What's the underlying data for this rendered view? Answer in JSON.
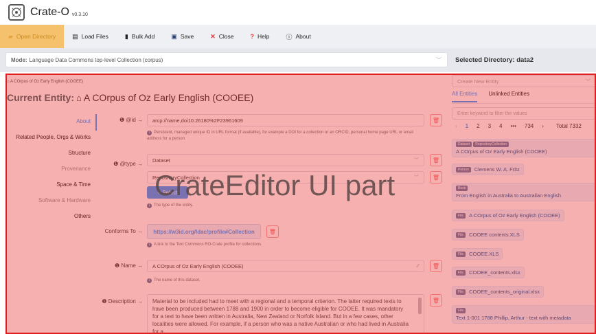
{
  "app": {
    "name": "Crate-O",
    "version": "v0.3.10"
  },
  "toolbar": {
    "items": [
      {
        "label": "Open Directory",
        "icon": "folder-open-icon",
        "active": true
      },
      {
        "label": "Load Files",
        "icon": "load-files-icon"
      },
      {
        "label": "Bulk Add",
        "icon": "bulk-add-icon"
      },
      {
        "label": "Save",
        "icon": "save-icon"
      },
      {
        "label": "Close",
        "icon": "close-icon"
      },
      {
        "label": "Help",
        "icon": "help-icon"
      },
      {
        "label": "About",
        "icon": "about-icon"
      }
    ]
  },
  "modebar": {
    "mode_label": "Mode:",
    "mode_value": "Language Data Commons top-level Collection (corpus)",
    "selected_dir": "Selected Directory: data2"
  },
  "editor": {
    "breadcrumb": "A COrpus of Oz Early English (COOEE)",
    "current_label": "Current Entity:",
    "current_name": "A COrpus of Oz Early English (COOEE)",
    "nav": [
      "About",
      "Related People, Orgs & Works",
      "Structure",
      "Provenance",
      "Space & Time",
      "Software & Hardware",
      "Others"
    ],
    "id_label": "@id →",
    "id_value": "arcp://name,doi10.26180%2F23961609",
    "id_hint": "Persistent, managed unique ID in URL format (if available), for example a DOI for a collection or an ORCID, personal home page URL or email address for a person",
    "type_label": "@type →",
    "type_values": [
      "Dataset",
      "RepositoryCollection"
    ],
    "select_label": "+ Select",
    "type_hint": "The type of the entity.",
    "conforms_label": "Conforms To →",
    "conforms_value": "https://w3id.org/ldac/profile#Collection",
    "conforms_hint": "A link to the Text Commons RO-Crate profile for collections.",
    "name_label": "Name →",
    "name_value": "A COrpus of Oz Early English (COOEE)",
    "name_hint": "The name of this dataset.",
    "desc_label": "Description →",
    "desc_value": "Material to be included had to meet with a regional and a temporal criterion. The latter required texts to have been produced between 1788 and 1900 in order to become eligible for COOEE. It was mandatory for a text to have been written in Australia, New Zealand or Norfolk Island. But in a few cases, other localities were allowed. For example, if a person who was a native Australian or who had lived in Australia for a"
  },
  "right": {
    "create_placeholder": "Create New Entity",
    "tabs": [
      "All Entities",
      "Unlinked Entities"
    ],
    "filter_placeholder": "Enter keyword to filter the values",
    "pager": {
      "prev": "‹",
      "pages": [
        "1",
        "2",
        "3",
        "4",
        "•••",
        "734"
      ],
      "next": "›",
      "total": "Total 7332"
    },
    "entities": [
      {
        "tags": [
          "Dataset",
          "RepositoryCollection"
        ],
        "name": "A COrpus of Oz Early English (COOEE)"
      },
      {
        "tags": [
          "Person"
        ],
        "name": "Clemens W. A. Fritz"
      },
      {
        "tags": [
          "Book"
        ],
        "name": "From English in Australia to Australian English"
      },
      {
        "tags": [
          "File"
        ],
        "name": "A COrpus of Oz Early English (COOEE)"
      },
      {
        "tags": [
          "File"
        ],
        "name": "COOEE contents.XLS"
      },
      {
        "tags": [
          "File"
        ],
        "name": "COOEE.XLS"
      },
      {
        "tags": [
          "File"
        ],
        "name": "COOEE_contents.xlsx"
      },
      {
        "tags": [
          "File"
        ],
        "name": "COOEE_contents_original.xlsx"
      },
      {
        "tags": [
          "File"
        ],
        "name": "Text 1-001 1788 Phillip, Arthur - text with metadata"
      }
    ]
  },
  "overlay": {
    "text": "CrateEditor UI part",
    "color": "#e02020"
  }
}
